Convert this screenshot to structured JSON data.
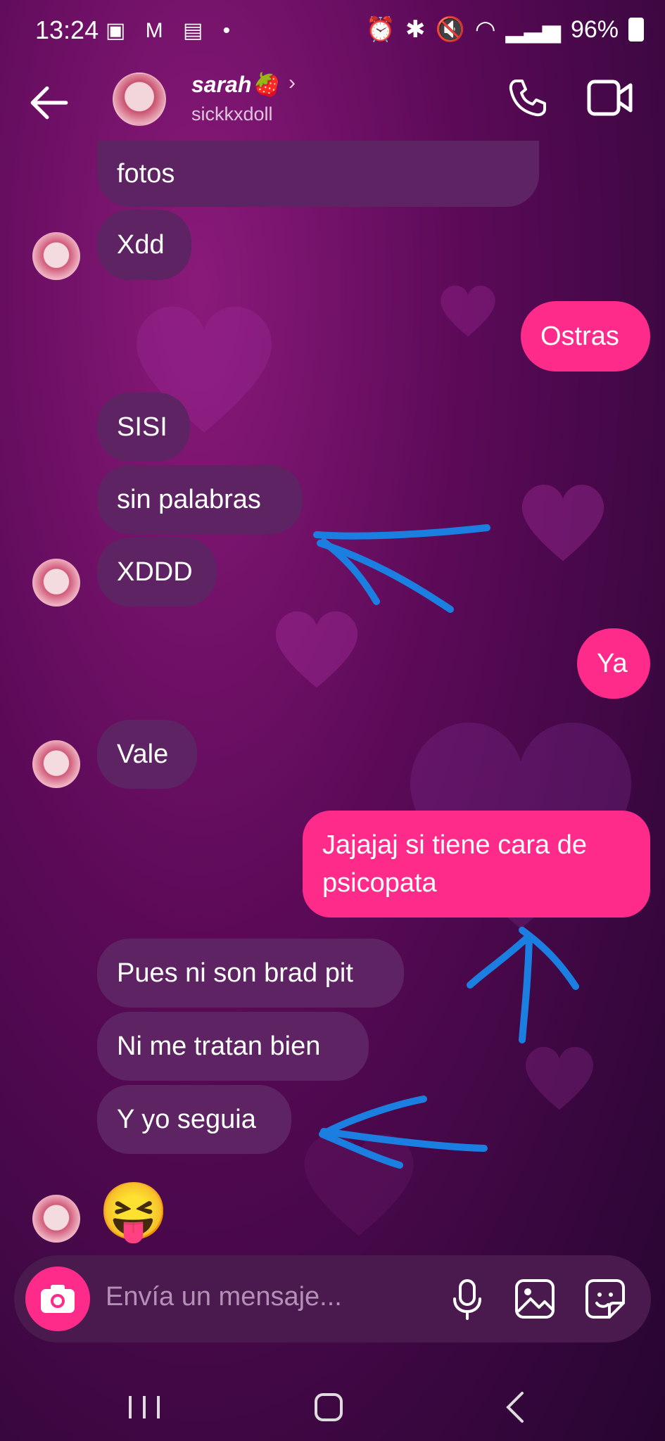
{
  "status": {
    "time": "13:24",
    "left_icons": "▣ M ▤ •",
    "battery": "96%"
  },
  "header": {
    "name": "sarah🍓",
    "username": "sickkxdoll"
  },
  "messages": [
    {
      "dir": "in",
      "text": "fotos"
    },
    {
      "dir": "in",
      "text": "Xdd"
    },
    {
      "dir": "out",
      "text": "Ostras"
    },
    {
      "dir": "in",
      "text": "SISI"
    },
    {
      "dir": "in",
      "text": "sin palabras"
    },
    {
      "dir": "in",
      "text": "XDDD"
    },
    {
      "dir": "out",
      "text": "Ya"
    },
    {
      "dir": "in",
      "text": "Vale"
    },
    {
      "dir": "out",
      "text": "Jajajaj si tiene cara de psicopata"
    },
    {
      "dir": "in",
      "text": "Pues ni son brad pit"
    },
    {
      "dir": "in",
      "text": "Ni me tratan bien"
    },
    {
      "dir": "in",
      "text": "Y yo seguia"
    },
    {
      "dir": "in",
      "text": "😝"
    }
  ],
  "composer": {
    "placeholder": "Envía un mensaje..."
  },
  "colors": {
    "incoming": "#5e2363",
    "outgoing": "#ff2b8a",
    "annotation": "#1a7fe0"
  }
}
